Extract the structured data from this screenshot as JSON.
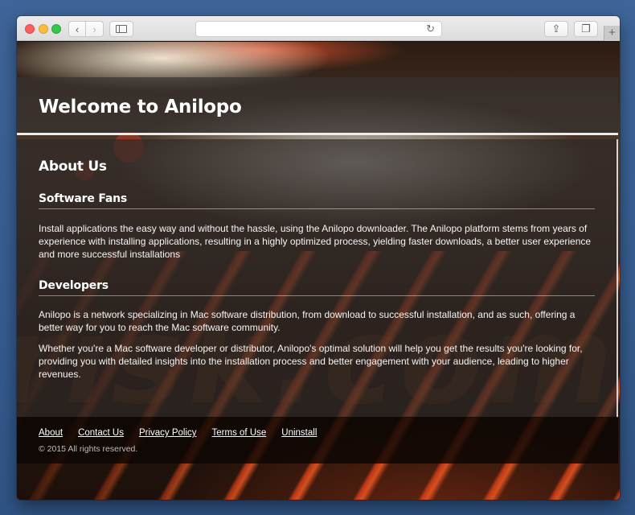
{
  "browser": {
    "address_value": "",
    "buttons": {
      "back": "‹",
      "forward": "›",
      "reload": "↻",
      "share": "⇪",
      "tabs": "❐",
      "new_tab": "+"
    }
  },
  "header": {
    "title": "Welcome to Anilopo"
  },
  "main": {
    "about_title": "About Us",
    "sections": [
      {
        "title": "Software Fans",
        "paragraphs": [
          "Install applications the easy way and without the hassle, using the Anilopo downloader. The Anilopo platform stems from years of experience with installing applications, resulting in a highly optimized process, yielding faster downloads, a better user experience and more successful installations"
        ]
      },
      {
        "title": "Developers",
        "paragraphs": [
          "Anilopo is a network specializing in Mac software distribution, from download to successful installation, and as such, offering a better way for you to reach the Mac software community.",
          "Whether you're a Mac software developer or distributor, Anilopo's optimal solution will help you get the results you're looking for, providing you with detailed insights into the installation process and better engagement with your audience, leading to higher revenues."
        ]
      }
    ]
  },
  "footer": {
    "links": [
      "About",
      "Contact Us",
      "Privacy Policy",
      "Terms of Use",
      "Uninstall"
    ],
    "copyright": "© 2015 All rights reserved."
  },
  "watermark": {
    "text": "risk.com"
  }
}
